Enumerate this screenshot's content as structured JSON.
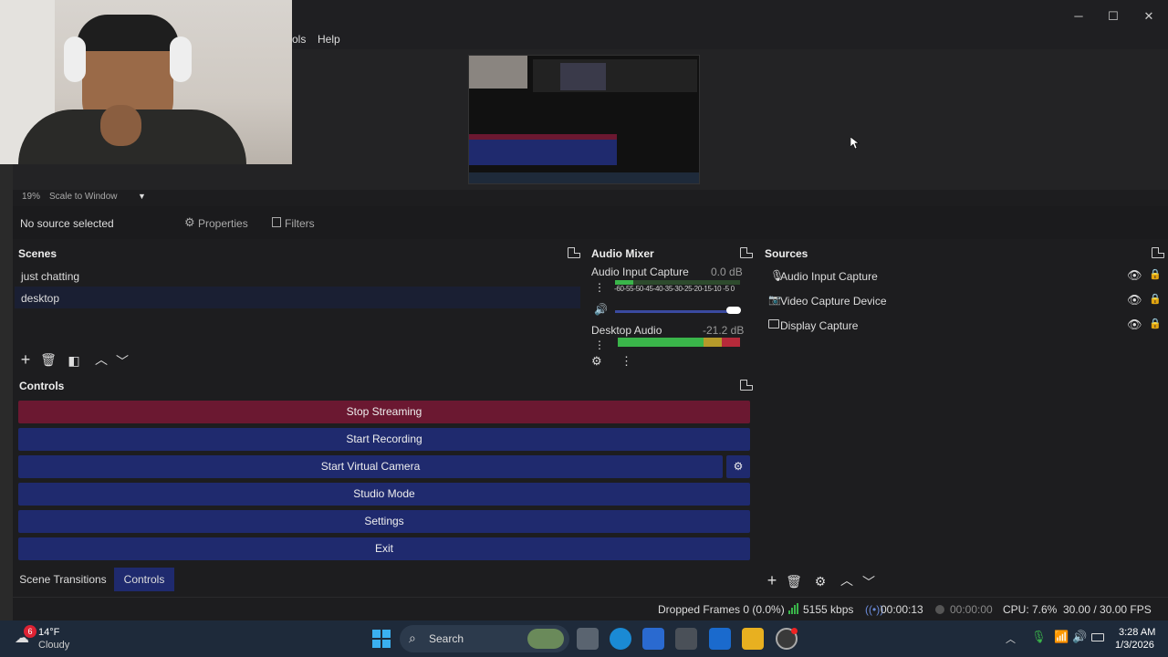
{
  "window": {
    "menu": [
      "ols",
      "Help"
    ]
  },
  "preview": {
    "zoom": "19%",
    "scale_mode": "Scale to Window"
  },
  "source_toolbar": {
    "status": "No source selected",
    "properties": "Properties",
    "filters": "Filters"
  },
  "scenes": {
    "title": "Scenes",
    "items": [
      {
        "label": "just chatting",
        "selected": false
      },
      {
        "label": "desktop",
        "selected": true
      }
    ]
  },
  "mixer": {
    "title": "Audio Mixer",
    "channels": [
      {
        "name": "Audio Input Capture",
        "db": "0.0 dB",
        "scale": "-60-55-50-45-40-35-30-25-20-15-10 -5  0",
        "level": 0.15,
        "volume": 1.0
      },
      {
        "name": "Desktop Audio",
        "db": "-21.2 dB",
        "level": 0.7
      }
    ]
  },
  "sources": {
    "title": "Sources",
    "items": [
      {
        "label": "Audio Input Capture",
        "icon": "microphone-icon"
      },
      {
        "label": "Video Capture Device",
        "icon": "camera-icon"
      },
      {
        "label": "Display Capture",
        "icon": "monitor-icon"
      }
    ]
  },
  "controls": {
    "title": "Controls",
    "stop_streaming": "Stop Streaming",
    "start_recording": "Start Recording",
    "start_virtual_camera": "Start Virtual Camera",
    "studio_mode": "Studio Mode",
    "settings": "Settings",
    "exit": "Exit"
  },
  "bottom_tabs": {
    "scene_transitions": "Scene Transitions",
    "controls": "Controls"
  },
  "status": {
    "dropped_frames": "Dropped Frames 0 (0.0%)",
    "bitrate": "5155 kbps",
    "stream_time": "00:00:13",
    "record_time": "00:00:00",
    "cpu": "CPU: 7.6%",
    "fps": "30.00 / 30.00 FPS"
  },
  "taskbar": {
    "weather_temp": "14°F",
    "weather_desc": "Cloudy",
    "weather_badge": "6",
    "search": "Search",
    "time": "3:28 AM",
    "date": "1/3/2026"
  },
  "colors": {
    "stream_red": "#6b1831",
    "control_blue": "#1f2a6e",
    "status_green": "#3ab54a"
  }
}
